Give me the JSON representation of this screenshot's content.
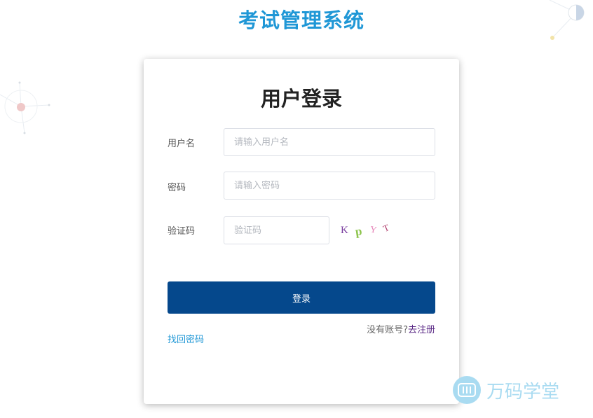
{
  "app": {
    "title": "考试管理系统"
  },
  "login": {
    "title": "用户登录",
    "username": {
      "label": "用户名",
      "placeholder": "请输入用户名",
      "value": ""
    },
    "password": {
      "label": "密码",
      "placeholder": "请输入密码",
      "value": ""
    },
    "captcha": {
      "label": "验证码",
      "placeholder": "验证码",
      "value": "",
      "chars": [
        "K",
        "p",
        "Y",
        "T"
      ],
      "colors": [
        "#7b3fa0",
        "#8bc34a",
        "#e57fb5",
        "#b03a6a"
      ]
    },
    "submit_label": "登录",
    "no_account_text": "没有账号?",
    "register_label": "去注册",
    "forgot_label": "找回密码"
  },
  "watermark": {
    "text": "万码学堂"
  },
  "colors": {
    "accent": "#1f97d6",
    "button": "#05488c",
    "register_link": "#5b2a86",
    "watermark": "#a9dbf1"
  }
}
